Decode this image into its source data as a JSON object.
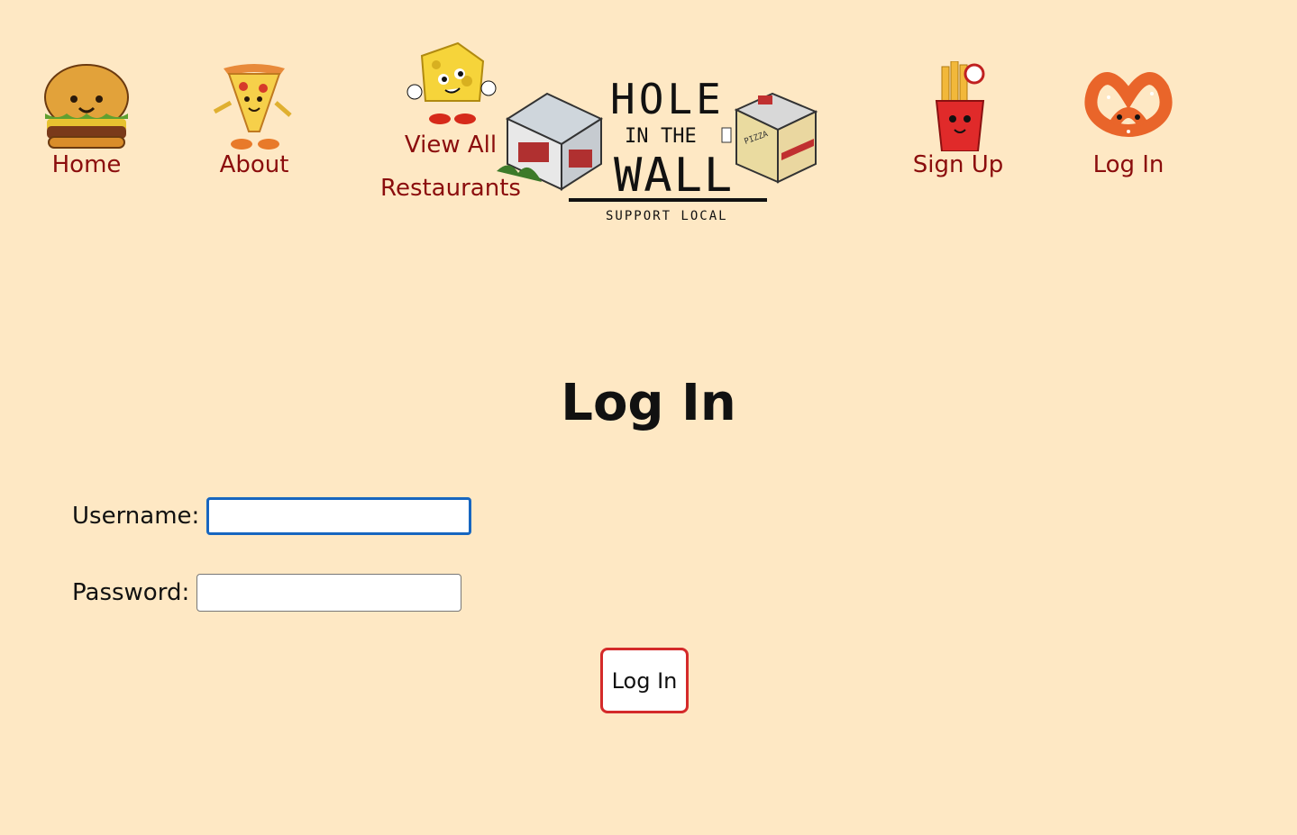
{
  "nav": {
    "home": "Home",
    "about": "About",
    "view_all_line1": "View All",
    "view_all_line2": "Restaurants",
    "sign_up": "Sign Up",
    "log_in": "Log In",
    "icons": {
      "home": "burger-icon",
      "about": "pizza-slice-icon",
      "view_all": "cheese-icon",
      "sign_up": "fries-icon",
      "log_in": "pretzel-icon"
    }
  },
  "logo": {
    "line1": "HOLE",
    "line2a": "IN",
    "line2b": "THE",
    "line3": "WALL",
    "tagline": "SUPPORT LOCAL",
    "sign_text": "PIZZA"
  },
  "main": {
    "title": "Log In",
    "username_label": "Username:",
    "username_value": "",
    "password_label": "Password:",
    "password_value": "",
    "submit_label": "Log In"
  },
  "colors": {
    "background": "#fee8c4",
    "nav_text": "#8b0d0d",
    "focus_ring": "#1766c0",
    "button_border": "#d42a2a"
  }
}
